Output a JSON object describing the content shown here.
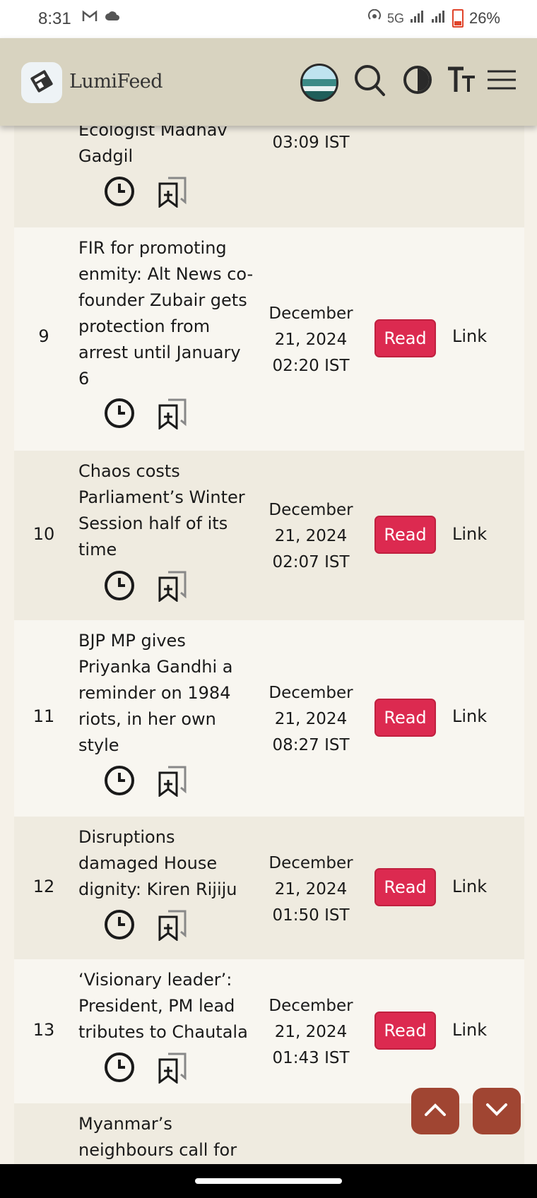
{
  "status_bar": {
    "time": "8:31",
    "network": "5G",
    "battery": "26%"
  },
  "header": {
    "app_name": "LumiFeed"
  },
  "partial_top": {
    "title": "Ecologist Madhav Gadgil",
    "date_line": "03:09 IST"
  },
  "rows": [
    {
      "num": "9",
      "title_lines": [
        "FIR for promoting",
        "enmity: Alt News co-",
        "founder Zubair gets",
        "protection from",
        "arrest until January",
        "6"
      ],
      "date_lines": [
        "December",
        "21, 2024",
        "02:20 IST"
      ],
      "read": "Read",
      "link": "Link"
    },
    {
      "num": "10",
      "title_lines": [
        "Chaos costs",
        "Parliament’s Winter",
        "Session half of its",
        "time"
      ],
      "date_lines": [
        "December",
        "21, 2024",
        "02:07 IST"
      ],
      "read": "Read",
      "link": "Link"
    },
    {
      "num": "11",
      "title_lines": [
        "BJP MP gives",
        "Priyanka Gandhi a",
        "reminder on 1984",
        "riots, in her own",
        "style"
      ],
      "date_lines": [
        "December",
        "21, 2024",
        "08:27 IST"
      ],
      "read": "Read",
      "link": "Link"
    },
    {
      "num": "12",
      "title_lines": [
        "Disruptions",
        "damaged House",
        "dignity: Kiren Rijiju"
      ],
      "date_lines": [
        "December",
        "21, 2024",
        "01:50 IST"
      ],
      "read": "Read",
      "link": "Link"
    },
    {
      "num": "13",
      "title_lines": [
        "‘Visionary leader’:",
        "President, PM lead",
        "tributes to Chautala"
      ],
      "date_lines": [
        "December",
        "21, 2024",
        "01:43 IST"
      ],
      "read": "Read",
      "link": "Link"
    }
  ],
  "partial_bottom": {
    "title_lines": [
      "Myanmar’s",
      "neighbours call for"
    ]
  }
}
